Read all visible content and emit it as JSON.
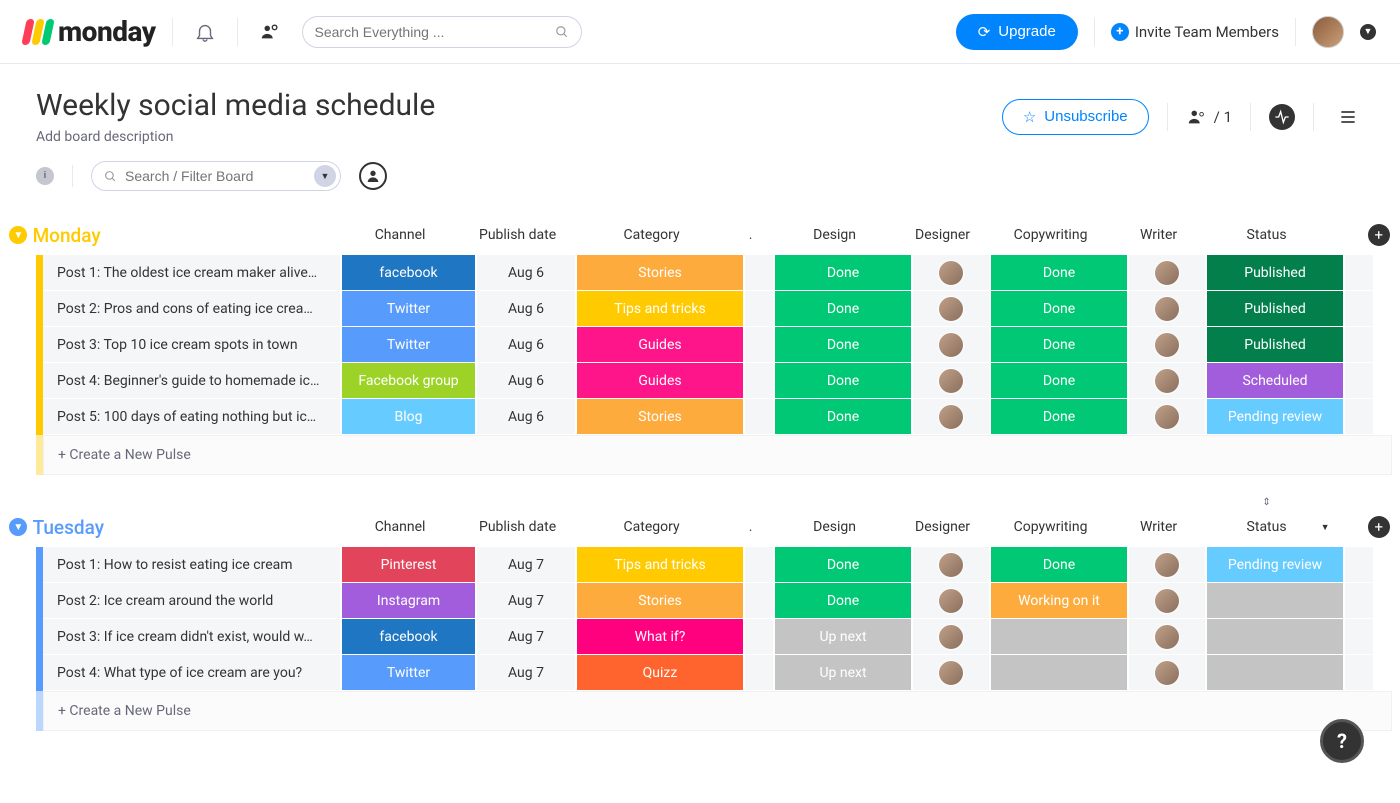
{
  "brand": {
    "name": "monday",
    "marks": [
      "#ff3d57",
      "#ffcb00",
      "#00ca72"
    ]
  },
  "search": {
    "placeholder": "Search Everything ..."
  },
  "upgrade_label": "Upgrade",
  "invite_label": "Invite Team Members",
  "board": {
    "title": "Weekly social media schedule",
    "description_placeholder": "Add board description",
    "unsubscribe_label": "Unsubscribe",
    "members_count": "/ 1"
  },
  "board_search": {
    "placeholder": "Search / Filter Board"
  },
  "columns": [
    "Channel",
    "Publish date",
    "Category",
    ".",
    "Design",
    "Designer",
    "Copywriting",
    "Writer",
    "Status"
  ],
  "new_pulse_label": "+ Create a New Pulse",
  "groups": [
    {
      "name": "Monday",
      "color": "#ffcb00",
      "rows": [
        {
          "task": "Post 1: The oldest ice cream maker alive…",
          "channel": "facebook",
          "channel_cls": "c-facebook",
          "date": "Aug 6",
          "category": "Stories",
          "cat_cls": "cat-stories",
          "design": "Done",
          "design_cls": "s-done",
          "copy": "Done",
          "copy_cls": "s-done",
          "status": "Published",
          "status_cls": "s-published"
        },
        {
          "task": "Post 2: Pros and cons of eating ice crea…",
          "channel": "Twitter",
          "channel_cls": "c-twitter",
          "date": "Aug 6",
          "category": "Tips and tricks",
          "cat_cls": "cat-tips",
          "design": "Done",
          "design_cls": "s-done",
          "copy": "Done",
          "copy_cls": "s-done",
          "status": "Published",
          "status_cls": "s-published"
        },
        {
          "task": "Post 3: Top 10 ice cream spots in town",
          "channel": "Twitter",
          "channel_cls": "c-twitter",
          "date": "Aug 6",
          "category": "Guides",
          "cat_cls": "cat-guides",
          "design": "Done",
          "design_cls": "s-done",
          "copy": "Done",
          "copy_cls": "s-done",
          "status": "Published",
          "status_cls": "s-published"
        },
        {
          "task": "Post 4: Beginner's guide to homemade ic…",
          "channel": "Facebook group",
          "channel_cls": "c-fbgroup",
          "date": "Aug 6",
          "category": "Guides",
          "cat_cls": "cat-guides",
          "design": "Done",
          "design_cls": "s-done",
          "copy": "Done",
          "copy_cls": "s-done",
          "status": "Scheduled",
          "status_cls": "s-scheduled"
        },
        {
          "task": "Post 5: 100 days of eating nothing but ic…",
          "channel": "Blog",
          "channel_cls": "c-blog",
          "date": "Aug 6",
          "category": "Stories",
          "cat_cls": "cat-stories",
          "design": "Done",
          "design_cls": "s-done",
          "copy": "Done",
          "copy_cls": "s-done",
          "status": "Pending review",
          "status_cls": "s-pending"
        }
      ]
    },
    {
      "name": "Tuesday",
      "color": "#579bfc",
      "status_sort": true,
      "rows": [
        {
          "task": "Post 1: How to resist eating ice cream",
          "channel": "Pinterest",
          "channel_cls": "c-pinterest",
          "date": "Aug 7",
          "category": "Tips and tricks",
          "cat_cls": "cat-tips",
          "design": "Done",
          "design_cls": "s-done",
          "copy": "Done",
          "copy_cls": "s-done",
          "status": "Pending review",
          "status_cls": "s-pending"
        },
        {
          "task": "Post 2: Ice cream around the world",
          "channel": "Instagram",
          "channel_cls": "c-instagram",
          "date": "Aug 7",
          "category": "Stories",
          "cat_cls": "cat-stories",
          "design": "Done",
          "design_cls": "s-done",
          "copy": "Working on it",
          "copy_cls": "s-working",
          "status": "",
          "status_cls": "s-empty"
        },
        {
          "task": "Post 3: If ice cream didn't exist, would w…",
          "channel": "facebook",
          "channel_cls": "c-facebook",
          "date": "Aug 7",
          "category": "What if?",
          "cat_cls": "cat-whatif",
          "design": "Up next",
          "design_cls": "s-upnext",
          "copy": "",
          "copy_cls": "s-empty",
          "status": "",
          "status_cls": "s-empty"
        },
        {
          "task": "Post 4: What type of ice cream are you?",
          "channel": "Twitter",
          "channel_cls": "c-twitter",
          "date": "Aug 7",
          "category": "Quizz",
          "cat_cls": "cat-quizz",
          "design": "Up next",
          "design_cls": "s-upnext",
          "copy": "",
          "copy_cls": "s-empty",
          "status": "",
          "status_cls": "s-empty"
        }
      ]
    }
  ]
}
